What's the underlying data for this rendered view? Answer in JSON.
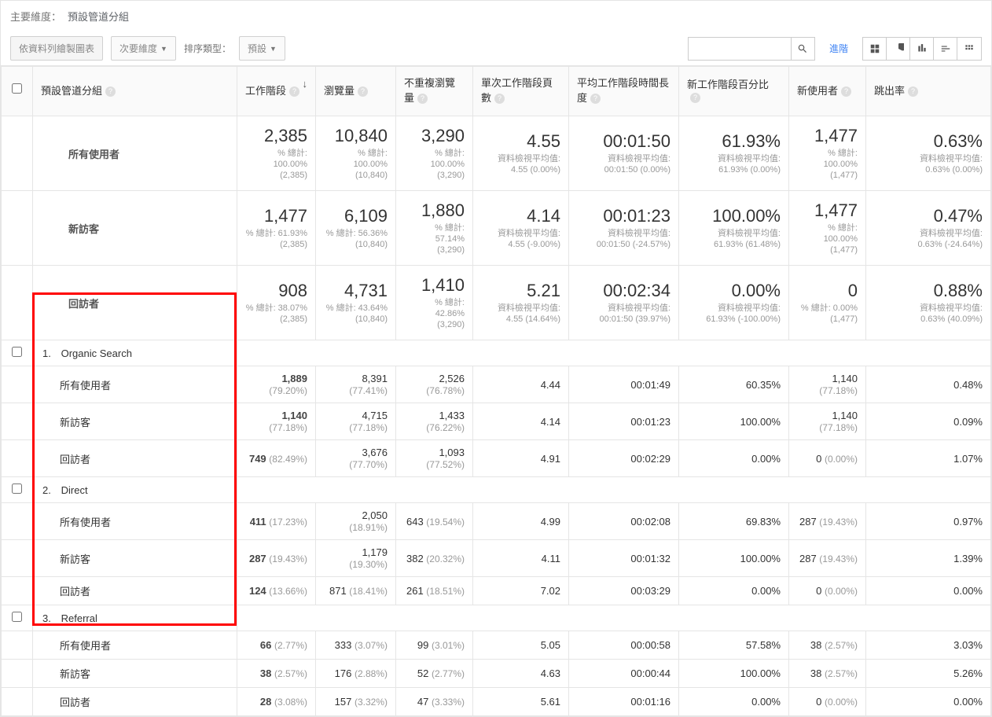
{
  "dimBar": {
    "label": "主要維度：",
    "value": "預設管道分組"
  },
  "toolbar": {
    "plotBtn": "依資料列繪製圖表",
    "secondaryDim": "次要維度",
    "sortLabel": "排序類型：",
    "sortDefault": "預設",
    "advanced": "進階"
  },
  "headers": {
    "channel": "預設管道分組",
    "sessions": "工作階段",
    "pageviews": "瀏覽量",
    "uniquePv": "不重複瀏覽量",
    "pagesPerSession": "單次工作階段頁數",
    "avgDuration": "平均工作階段時間長度",
    "newSessPct": "新工作階段百分比",
    "newUsers": "新使用者",
    "bounce": "跳出率"
  },
  "summary": [
    {
      "name": "所有使用者",
      "sessions": {
        "big": "2,385",
        "sub1": "% 總計:",
        "sub2": "100.00%",
        "sub3": "(2,385)"
      },
      "pageviews": {
        "big": "10,840",
        "sub1": "% 總計:",
        "sub2": "100.00%",
        "sub3": "(10,840)"
      },
      "uniquePv": {
        "big": "3,290",
        "sub1": "% 總計:",
        "sub2": "100.00%",
        "sub3": "(3,290)"
      },
      "pps": {
        "big": "4.55",
        "sub1": "資料檢視平均值:",
        "sub2": "4.55 (0.00%)"
      },
      "dur": {
        "big": "00:01:50",
        "sub1": "資料檢視平均值:",
        "sub2": "00:01:50 (0.00%)"
      },
      "nsp": {
        "big": "61.93%",
        "sub1": "資料檢視平均值:",
        "sub2": "61.93% (0.00%)"
      },
      "nu": {
        "big": "1,477",
        "sub1": "% 總計:",
        "sub2": "100.00%",
        "sub3": "(1,477)"
      },
      "br": {
        "big": "0.63%",
        "sub1": "資料檢視平均值:",
        "sub2": "0.63% (0.00%)"
      }
    },
    {
      "name": "新訪客",
      "sessions": {
        "big": "1,477",
        "sub1": "% 總計: 61.93%",
        "sub2": "(2,385)"
      },
      "pageviews": {
        "big": "6,109",
        "sub1": "% 總計: 56.36%",
        "sub2": "(10,840)"
      },
      "uniquePv": {
        "big": "1,880",
        "sub1": "% 總計: 57.14%",
        "sub2": "(3,290)"
      },
      "pps": {
        "big": "4.14",
        "sub1": "資料檢視平均值:",
        "sub2": "4.55 (-9.00%)"
      },
      "dur": {
        "big": "00:01:23",
        "sub1": "資料檢視平均值:",
        "sub2": "00:01:50 (-24.57%)"
      },
      "nsp": {
        "big": "100.00%",
        "sub1": "資料檢視平均值:",
        "sub2": "61.93% (61.48%)"
      },
      "nu": {
        "big": "1,477",
        "sub1": "% 總計:",
        "sub2": "100.00%",
        "sub3": "(1,477)"
      },
      "br": {
        "big": "0.47%",
        "sub1": "資料檢視平均值:",
        "sub2": "0.63% (-24.64%)"
      }
    },
    {
      "name": "回訪者",
      "sessions": {
        "big": "908",
        "sub1": "% 總計: 38.07%",
        "sub2": "(2,385)"
      },
      "pageviews": {
        "big": "4,731",
        "sub1": "% 總計: 43.64%",
        "sub2": "(10,840)"
      },
      "uniquePv": {
        "big": "1,410",
        "sub1": "% 總計: 42.86%",
        "sub2": "(3,290)"
      },
      "pps": {
        "big": "5.21",
        "sub1": "資料檢視平均值:",
        "sub2": "4.55 (14.64%)"
      },
      "dur": {
        "big": "00:02:34",
        "sub1": "資料檢視平均值:",
        "sub2": "00:01:50 (39.97%)"
      },
      "nsp": {
        "big": "0.00%",
        "sub1": "資料檢視平均值:",
        "sub2": "61.93% (-100.00%)"
      },
      "nu": {
        "big": "0",
        "sub1": "% 總計: 0.00%",
        "sub2": "(1,477)"
      },
      "br": {
        "big": "0.88%",
        "sub1": "資料檢視平均值:",
        "sub2": "0.63% (40.09%)"
      }
    }
  ],
  "groups": [
    {
      "idx": "1.",
      "name": "Organic Search",
      "rows": [
        {
          "seg": "所有使用者",
          "s": "1,889",
          "sp": "(79.20%)",
          "pv": "8,391",
          "pvp": "(77.41%)",
          "u": "2,526",
          "up": "(76.78%)",
          "pps": "4.44",
          "d": "00:01:49",
          "n": "60.35%",
          "nu": "1,140",
          "nup": "(77.18%)",
          "b": "0.48%"
        },
        {
          "seg": "新訪客",
          "s": "1,140",
          "sp": "(77.18%)",
          "pv": "4,715",
          "pvp": "(77.18%)",
          "u": "1,433",
          "up": "(76.22%)",
          "pps": "4.14",
          "d": "00:01:23",
          "n": "100.00%",
          "nu": "1,140",
          "nup": "(77.18%)",
          "b": "0.09%"
        },
        {
          "seg": "回訪者",
          "s": "749",
          "sp": "(82.49%)",
          "pv": "3,676",
          "pvp": "(77.70%)",
          "u": "1,093",
          "up": "(77.52%)",
          "pps": "4.91",
          "d": "00:02:29",
          "n": "0.00%",
          "nu": "0",
          "nup": "(0.00%)",
          "b": "1.07%"
        }
      ]
    },
    {
      "idx": "2.",
      "name": "Direct",
      "rows": [
        {
          "seg": "所有使用者",
          "s": "411",
          "sp": "(17.23%)",
          "pv": "2,050",
          "pvp": "(18.91%)",
          "u": "643",
          "up": "(19.54%)",
          "pps": "4.99",
          "d": "00:02:08",
          "n": "69.83%",
          "nu": "287",
          "nup": "(19.43%)",
          "b": "0.97%"
        },
        {
          "seg": "新訪客",
          "s": "287",
          "sp": "(19.43%)",
          "pv": "1,179",
          "pvp": "(19.30%)",
          "u": "382",
          "up": "(20.32%)",
          "pps": "4.11",
          "d": "00:01:32",
          "n": "100.00%",
          "nu": "287",
          "nup": "(19.43%)",
          "b": "1.39%"
        },
        {
          "seg": "回訪者",
          "s": "124",
          "sp": "(13.66%)",
          "pv": "871",
          "pvp": "(18.41%)",
          "u": "261",
          "up": "(18.51%)",
          "pps": "7.02",
          "d": "00:03:29",
          "n": "0.00%",
          "nu": "0",
          "nup": "(0.00%)",
          "b": "0.00%"
        }
      ]
    },
    {
      "idx": "3.",
      "name": "Referral",
      "rows": [
        {
          "seg": "所有使用者",
          "s": "66",
          "sp": "(2.77%)",
          "pv": "333",
          "pvp": "(3.07%)",
          "u": "99",
          "up": "(3.01%)",
          "pps": "5.05",
          "d": "00:00:58",
          "n": "57.58%",
          "nu": "38",
          "nup": "(2.57%)",
          "b": "3.03%"
        },
        {
          "seg": "新訪客",
          "s": "38",
          "sp": "(2.57%)",
          "pv": "176",
          "pvp": "(2.88%)",
          "u": "52",
          "up": "(2.77%)",
          "pps": "4.63",
          "d": "00:00:44",
          "n": "100.00%",
          "nu": "38",
          "nup": "(2.57%)",
          "b": "5.26%"
        },
        {
          "seg": "回訪者",
          "s": "28",
          "sp": "(3.08%)",
          "pv": "157",
          "pvp": "(3.32%)",
          "u": "47",
          "up": "(3.33%)",
          "pps": "5.61",
          "d": "00:01:16",
          "n": "0.00%",
          "nu": "0",
          "nup": "(0.00%)",
          "b": "0.00%"
        }
      ]
    }
  ]
}
